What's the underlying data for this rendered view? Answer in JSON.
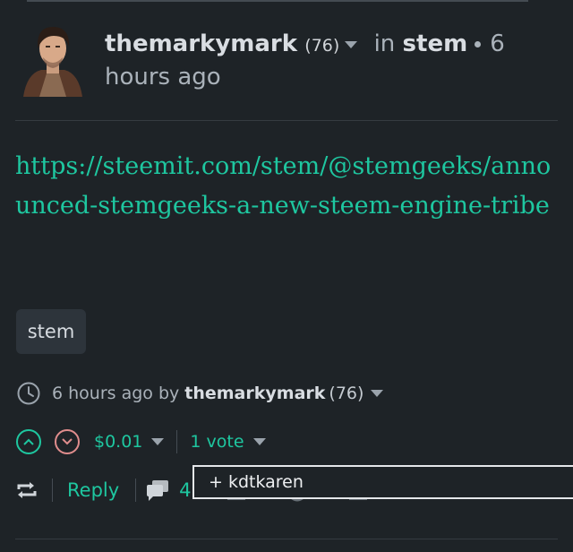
{
  "post": {
    "author": "themarkymark",
    "reputation": "(76)",
    "in_label": "in",
    "community": "stem",
    "time": "6 hours ago",
    "body_link": "https://steemit.com/stem/@stemgeeks/announced-stemgeeks-a-new-steem-engine-tribe",
    "tag": "stem"
  },
  "meta": {
    "time": "6 hours ago by",
    "author": "themarkymark",
    "reputation": "(76)"
  },
  "voting": {
    "payout": "$0.01",
    "votes": "1 vote"
  },
  "actions": {
    "reply_label": "Reply",
    "comments_count": "4"
  },
  "voter_popup": {
    "text": "+ kdtkaren"
  },
  "colors": {
    "background": "#1e2327",
    "accent": "#1ec7a0",
    "downvote": "#e08d8d"
  },
  "icons": [
    "clock-icon",
    "upvote-icon",
    "downvote-icon",
    "resteem-icon",
    "comments-icon",
    "caret-down-icon"
  ]
}
